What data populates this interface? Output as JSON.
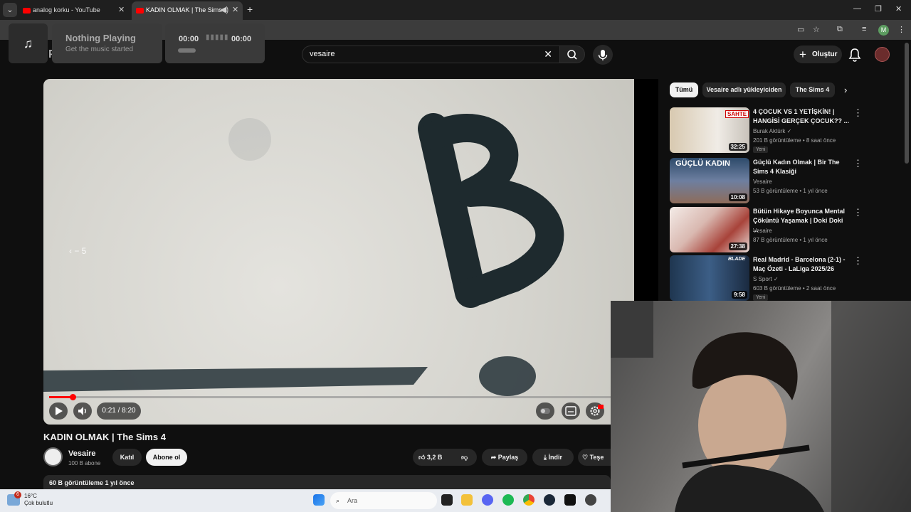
{
  "browser": {
    "tabs": [
      {
        "label": "analog korku - YouTube"
      },
      {
        "label": "KADIN OLMAK | The Sims 4"
      }
    ]
  },
  "music_widget": {
    "title": "Nothing Playing",
    "subtitle": "Get the music started",
    "elapsed": "00:00",
    "total": "00:00"
  },
  "youtube": {
    "search_value": "vesaire",
    "create_label": "Oluştur",
    "player": {
      "time": "0:21 / 8:20",
      "seek_hint": "‹  − 5",
      "progress": 0.042
    },
    "video": {
      "title": "KADIN OLMAK | The Sims 4",
      "channel": "Vesaire",
      "subscribers": "100 B abone",
      "join_label": "Katıl",
      "subscribe_label": "Abone ol",
      "likes": "3,2 B",
      "share_label": "Paylaş",
      "download_label": "İndir",
      "thanks_label": "Teşe",
      "description_line": "60 B görüntüleme  1 yıl önce"
    },
    "chips": [
      {
        "label": "Tümü"
      },
      {
        "label": "Vesaire adlı yükleyiciden"
      },
      {
        "label": "The Sims 4"
      }
    ],
    "recommendations": [
      {
        "title": "4 ÇOCUK VS 1 YETİŞKİN! | HANGİSİ GERÇEK ÇOCUK?? ...",
        "channel": "Burak Aktürk ✓",
        "meta": "201 B görüntüleme • 8 saat önce",
        "badge": "Yeni",
        "duration": "32:25",
        "thumb_text": "SAHTE"
      },
      {
        "title": "Güçlü Kadın Olmak | Bir The Sims 4 Klasiği",
        "channel": "Vesaire",
        "meta": "53 B görüntüleme • 1 yıl önce",
        "badge": "",
        "duration": "10:08",
        "thumb_text": "GÜÇLÜ KADIN"
      },
      {
        "title": "Bütün Hikaye Boyunca Mental Çöküntü Yaşamak | Doki Doki ...",
        "channel": "Vesaire",
        "meta": "87 B görüntüleme • 1 yıl önce",
        "badge": "",
        "duration": "27:38",
        "thumb_text": ""
      },
      {
        "title": "Real Madrid - Barcelona (2-1) - Maç Özeti - LaLiga 2025/26",
        "channel": "S Sport ✓",
        "meta": "603 B görüntüleme • 2 saat önce",
        "badge": "Yeni",
        "duration": "9:58",
        "thumb_text": "BLADE"
      }
    ]
  },
  "taskbar": {
    "temperature": "16°C",
    "weather": "Çok bulutlu",
    "search_placeholder": "Ara",
    "notification_count": "6"
  }
}
